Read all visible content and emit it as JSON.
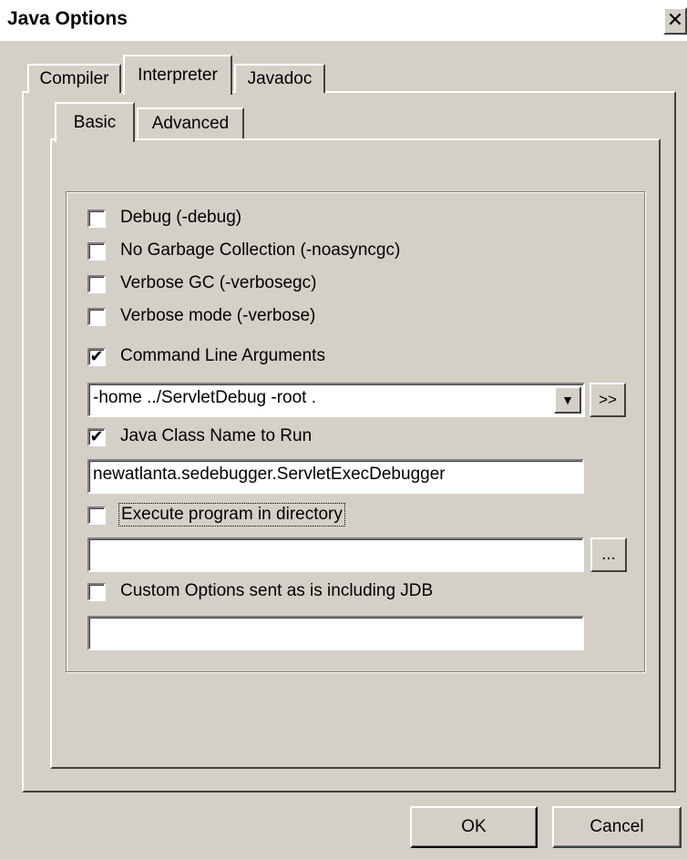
{
  "window": {
    "title": "Java Options",
    "close_glyph": "✕"
  },
  "tabs": [
    {
      "label": "Compiler"
    },
    {
      "label": "Interpreter"
    },
    {
      "label": "Javadoc"
    }
  ],
  "subtabs": [
    {
      "label": "Basic"
    },
    {
      "label": "Advanced"
    }
  ],
  "options": {
    "debug": {
      "label": "Debug (-debug)",
      "checked": false,
      "mark": ""
    },
    "no_gc": {
      "label": "No Garbage Collection (-noasyncgc)",
      "checked": false,
      "mark": ""
    },
    "verbose_gc": {
      "label": "Verbose GC (-verbosegc)",
      "checked": false,
      "mark": ""
    },
    "verbose_mode": {
      "label": "Verbose mode (-verbose)",
      "checked": false,
      "mark": ""
    },
    "cmd_args": {
      "label": "Command Line Arguments",
      "checked": true,
      "mark": "✔"
    },
    "class_name": {
      "label": "Java Class Name to Run",
      "checked": true,
      "mark": "✔"
    },
    "exec_dir": {
      "label": "Execute program in directory",
      "checked": false,
      "mark": ""
    },
    "custom": {
      "label": "Custom Options sent as is including JDB",
      "checked": false,
      "mark": ""
    }
  },
  "fields": {
    "cmd_args_value": "-home ../ServletDebug -root .",
    "class_name_value": "newatlanta.sedebugger.ServletExecDebugger",
    "exec_dir_value": "",
    "custom_value": ""
  },
  "buttons": {
    "expand": ">>",
    "browse": "...",
    "dropdown_glyph": "▼",
    "ok": "OK",
    "cancel": "Cancel"
  }
}
